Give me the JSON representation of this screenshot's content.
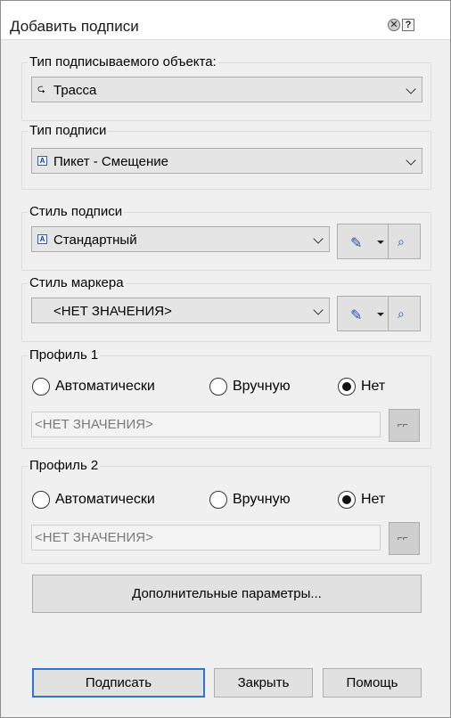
{
  "window": {
    "title": "Добавить подписи"
  },
  "titlebar": {
    "pin_icon": "pin-icon",
    "help_icon": "help-icon"
  },
  "object_type": {
    "label": "Тип подписываемого объекта:",
    "icon": "alignment-icon",
    "value": "Трасса"
  },
  "label_type": {
    "label": "Тип подписи",
    "icon": "label-icon",
    "value": "Пикет - Смещение"
  },
  "label_style": {
    "label": "Стиль подписи",
    "icon": "label-style-icon",
    "value": "Стандартный",
    "edit_icon": "edit-style-icon",
    "preview_icon": "preview-icon"
  },
  "marker_style": {
    "label": "Стиль маркера",
    "value": "<НЕТ ЗНАЧЕНИЯ>",
    "edit_icon": "edit-style-icon",
    "preview_icon": "preview-icon"
  },
  "profile1": {
    "label": "Профиль 1",
    "options": [
      "Автоматически",
      "Вручную",
      "Нет"
    ],
    "selected": "Нет",
    "value": "<НЕТ ЗНАЧЕНИЯ>",
    "pick_icon": "pick-profile-icon"
  },
  "profile2": {
    "label": "Профиль 2",
    "options": [
      "Автоматически",
      "Вручную",
      "Нет"
    ],
    "selected": "Нет",
    "value": "<НЕТ ЗНАЧЕНИЯ>",
    "pick_icon": "pick-profile-icon"
  },
  "buttons": {
    "more": "Дополнительные параметры...",
    "label": "Подписать",
    "close": "Закрыть",
    "help": "Помощь"
  }
}
